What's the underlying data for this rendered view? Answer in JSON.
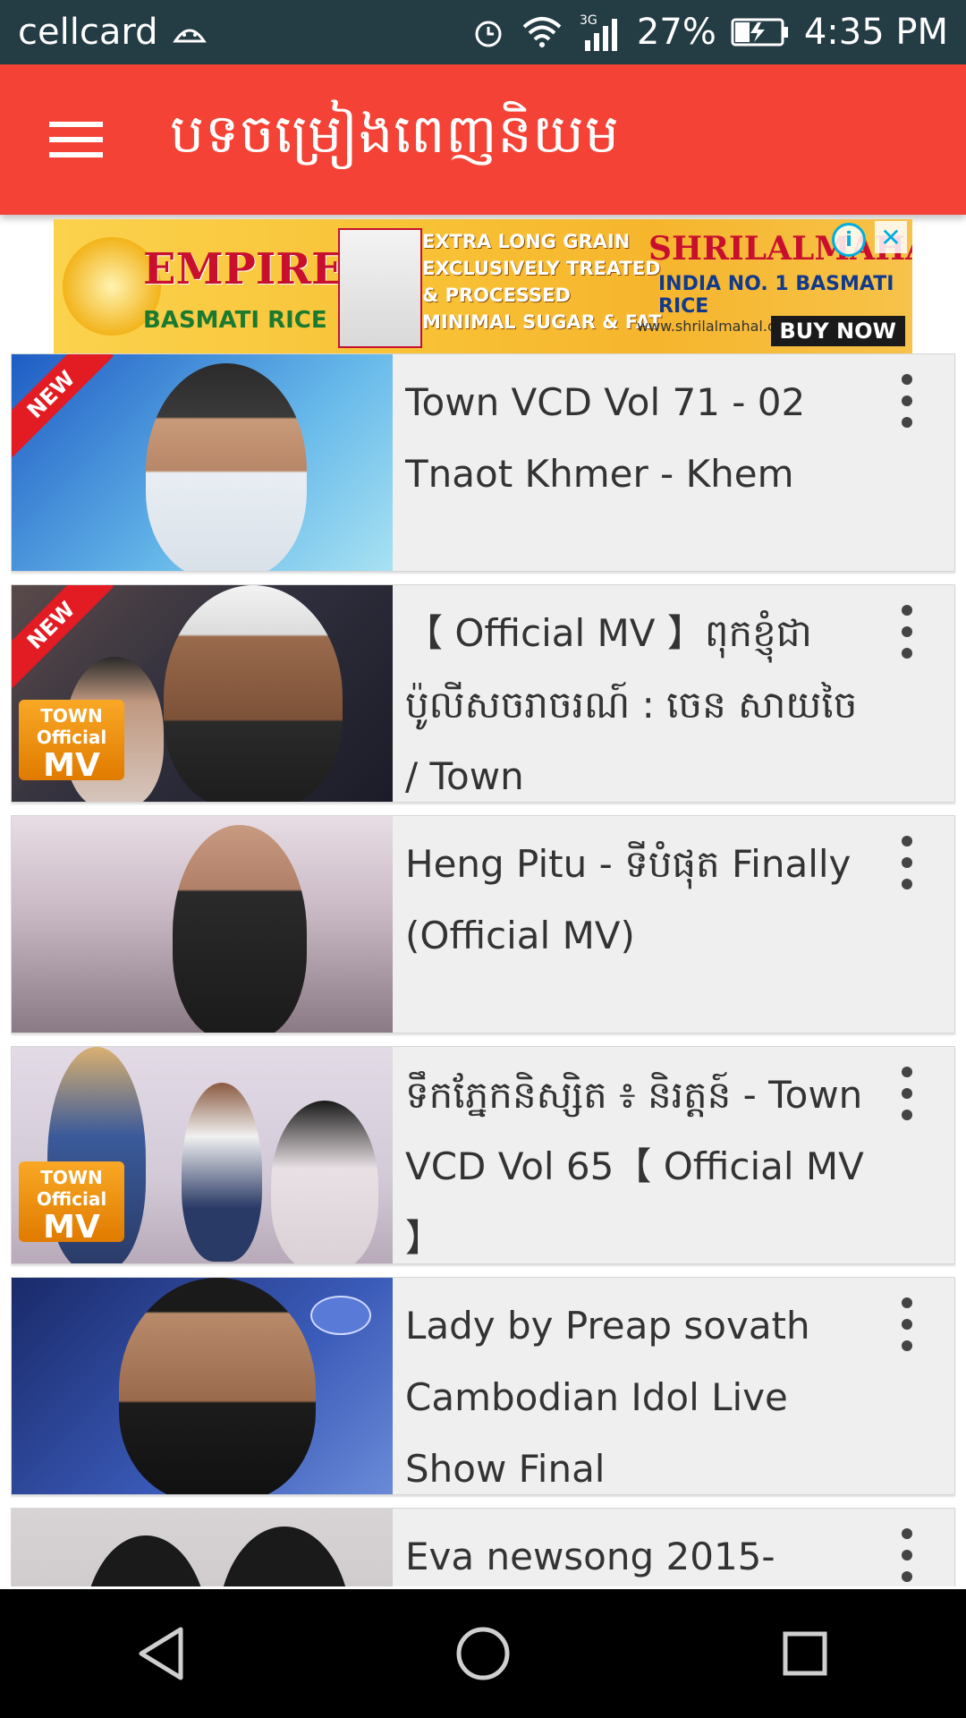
{
  "status_bar": {
    "carrier": "cellcard",
    "network_type": "3G",
    "battery_percent": "27%",
    "time": "4:35 PM"
  },
  "app_bar": {
    "title": "បទចម្រៀងពេញនិយម",
    "menu_icon": "hamburger-menu-icon"
  },
  "ad": {
    "brand_left": "EMPIRE",
    "brand_left_sub": "BASMATI RICE",
    "points": [
      "EXTRA LONG GRAIN",
      "EXCLUSIVELY TREATED & PROCESSED",
      "MINIMAL SUGAR & FAT"
    ],
    "brand_right": "SHRILALMAHAL",
    "tagline": "INDIA NO. 1 BASMATI RICE",
    "url": "www.shrilalmahal.org",
    "cta": "BUY NOW",
    "info_icon": "i",
    "close_icon": "✕"
  },
  "videos": [
    {
      "title": "Town VCD Vol 71 - 02 Tnaot Khmer - Khem",
      "badge": "NEW",
      "thumb_colors": [
        "#2a6fd6",
        "#8fd0f0"
      ]
    },
    {
      "title": "【 Official MV 】ពុកខ្ញុំជាប៉ូលីសចរាចរណ៍ : ចេន សាយចៃ / Town",
      "badge": "NEW",
      "mv_top": "TOWN",
      "mv_mid": "Official",
      "mv_big": "MV",
      "thumb_colors": [
        "#3a3a48",
        "#7a5a4a"
      ]
    },
    {
      "title": "Heng Pitu -  ទីបំផុត Finally (Official MV)",
      "thumb_colors": [
        "#b8a8b0",
        "#e8e0e6"
      ]
    },
    {
      "title": "ទឹកភ្នែកនិស្សិត ៖ និរត្តន៍ - Town VCD Vol 65【 Official MV 】",
      "mv_top": "TOWN",
      "mv_mid": "Official",
      "mv_big": "MV",
      "thumb_colors": [
        "#cfc7d6",
        "#f0e9ee"
      ]
    },
    {
      "title": "Lady by Preap sovath Cambodian Idol   Live Show   Final",
      "thumb_colors": [
        "#2a3b8a",
        "#5a79d0"
      ]
    },
    {
      "title": "Eva newsong 2015- ",
      "thumb_colors": [
        "#c9c6c9",
        "#e8e4e6"
      ]
    }
  ],
  "nav": {
    "back_icon": "back-triangle-icon",
    "home_icon": "home-circle-icon",
    "recents_icon": "recents-square-icon"
  }
}
